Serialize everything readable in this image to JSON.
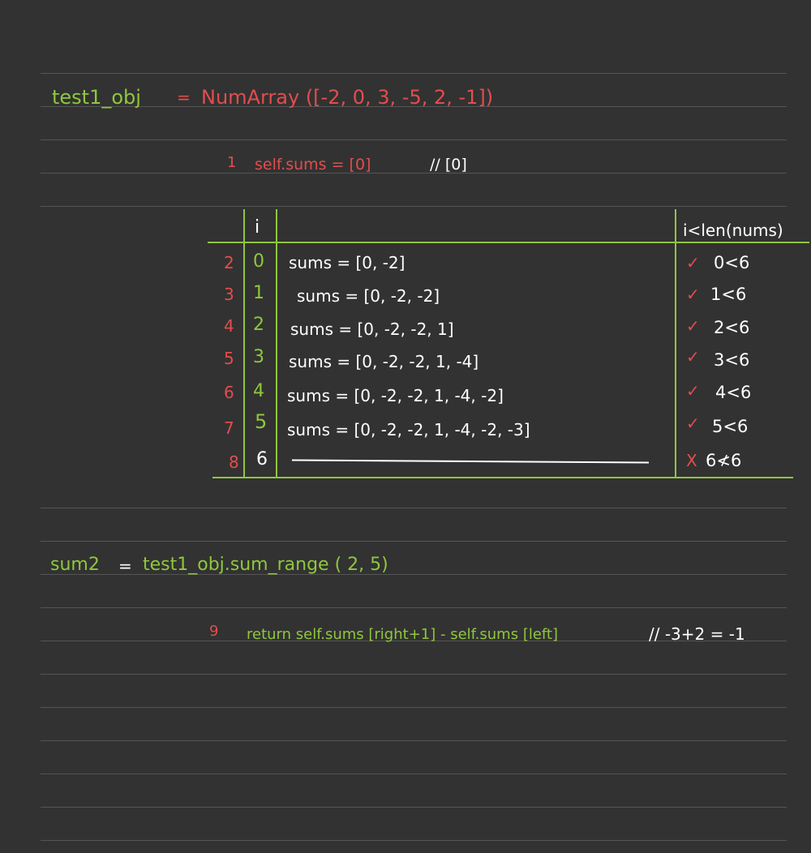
{
  "colors": {
    "background": "#323232",
    "ruled_line": "#555555",
    "green": "#8fc73e",
    "red": "#e34d4d",
    "white": "#ffffff"
  },
  "line1": {
    "var": "test1_obj",
    "eq": "=",
    "ctor": "NumArray ([-2, 0, 3, -5, 2, -1])"
  },
  "step1": {
    "num": "1",
    "code": "self.sums = [0]",
    "comment": "// [0]"
  },
  "table": {
    "col_i": "i",
    "col_cond": "i<len(nums)",
    "rows": [
      {
        "step": "2",
        "i": "0",
        "sums": "sums = [0, -2]",
        "mark": "✓",
        "cond": "0<6"
      },
      {
        "step": "3",
        "i": "1",
        "sums": "sums = [0, -2, -2]",
        "mark": "✓",
        "cond": "1<6"
      },
      {
        "step": "4",
        "i": "2",
        "sums": "sums = [0, -2, -2, 1]",
        "mark": "✓",
        "cond": "2<6"
      },
      {
        "step": "5",
        "i": "3",
        "sums": "sums = [0, -2, -2, 1, -4]",
        "mark": "✓",
        "cond": "3<6"
      },
      {
        "step": "6",
        "i": "4",
        "sums": "sums = [0, -2, -2, 1, -4, -2]",
        "mark": "✓",
        "cond": "4<6"
      },
      {
        "step": "7",
        "i": "5",
        "sums": "sums = [0, -2, -2, 1, -4, -2, -3]",
        "mark": "✓",
        "cond": "5<6"
      },
      {
        "step": "8",
        "i": "6",
        "sums": "",
        "mark": "X",
        "cond": "6≮6"
      }
    ]
  },
  "line2": {
    "var": "sum2",
    "eq": "=",
    "call": "test1_obj.sum_range ( 2, 5)"
  },
  "step9": {
    "num": "9",
    "code": "return self.sums [right+1] - self.sums [left]",
    "comment": "// -3+2 = -1"
  }
}
